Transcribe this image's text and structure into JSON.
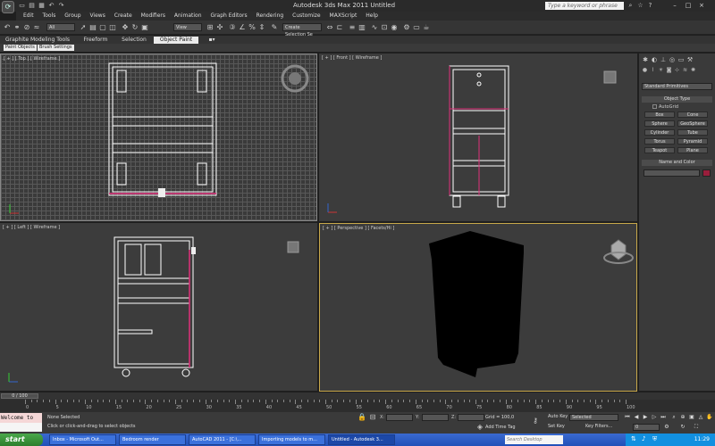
{
  "window": {
    "title": "Autodesk 3ds Max  2011     Untitled",
    "search_placeholder": "Type a keyword or phrase"
  },
  "menu": [
    "Edit",
    "Tools",
    "Group",
    "Views",
    "Create",
    "Modifiers",
    "Animation",
    "Graph Editors",
    "Rendering",
    "Customize",
    "MAXScript",
    "Help"
  ],
  "toolbar": {
    "filter_dd": "All",
    "refcoord_dd": "View",
    "selset_dd": "Create Selection Se"
  },
  "ribbon": {
    "tabs": [
      "Graphite Modeling Tools",
      "Freeform",
      "Selection",
      "Object Paint"
    ],
    "subtabs": [
      "Paint Objects",
      "Brush Settings"
    ]
  },
  "viewports": {
    "top": "[ + ] [ Top ] [ Wireframe ]",
    "front": "[ + ] [ Front ] [ Wireframe ]",
    "left": "[ + ] [ Left ] [ Wireframe ]",
    "persp": "[ + ] [ Perspective ] [ Facets/Hi ]"
  },
  "panel": {
    "primitives_dd": "Standard Primitives",
    "object_type_header": "Object Type",
    "autogrid": "AutoGrid",
    "objects": [
      "Box",
      "Cone",
      "Sphere",
      "GeoSphere",
      "Cylinder",
      "Tube",
      "Torus",
      "Pyramid",
      "Teapot",
      "Plane"
    ],
    "name_color_header": "Name and Color",
    "swatch_color": "#9a1e3c"
  },
  "timeline": {
    "frame_counter": "0 / 100",
    "ticks": [
      "0",
      "5",
      "10",
      "15",
      "20",
      "25",
      "30",
      "35",
      "40",
      "45",
      "50",
      "55",
      "60",
      "65",
      "70",
      "75",
      "80",
      "85",
      "90",
      "95",
      "100"
    ]
  },
  "status": {
    "maxscript": "Welcome to M:",
    "selection": "None Selected",
    "prompt": "Click or click-and-drag to select objects",
    "x": "X:",
    "y": "Y:",
    "z": "Z:",
    "grid": "Grid = 100,0",
    "add_time_tag": "Add Time Tag",
    "auto_key": "Auto Key",
    "set_key": "Set Key",
    "selected_dd": "Selected",
    "key_filters": "Key Filters...",
    "frame": "0"
  },
  "taskbar": {
    "start": "start",
    "tasks": [
      "Inbox - Microsoft Out...",
      "Bedroom render",
      "AutoCAD 2011 - [C:\\...",
      "Importing models to m...",
      "Untitled - Autodesk 3..."
    ],
    "desktop_search": "Search Desktop",
    "clock": "11:29"
  }
}
